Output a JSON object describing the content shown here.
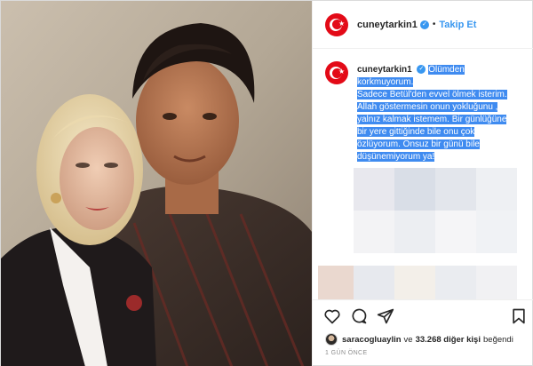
{
  "post": {
    "username": "cuneytarkin1",
    "verified_glyph": "✓",
    "separator": "•",
    "follow_label": "Takip Et",
    "caption_username": "cuneytarkin1",
    "caption_lines": [
      "Ölümden",
      "korkmuyorum.",
      "Sadece Betül'den evvel ölmek isterim.",
      "Allah göstermesin onun yokluğunu ,",
      "yalnız kalmak istemem. Bir günlüğüne",
      "bir yere gittiğinde bile onu çok",
      "özlüyorum. Onsuz bir günü bile",
      "düşünemiyorum ya!"
    ],
    "liked_by_user": "saracogluaylin",
    "liked_connector": "ve",
    "likes_count": "33.268 diğer kişi",
    "liked_suffix": "beğendi",
    "timestamp": "1 gün önce"
  },
  "icons": {
    "avatar": "turkish-flag-icon",
    "verified": "verified-badge-icon",
    "like": "heart-icon",
    "comment": "comment-icon",
    "share": "share-icon",
    "save": "bookmark-icon"
  },
  "colors": {
    "accent_blue": "#3897f0",
    "selection_blue": "#3f8bf0",
    "flag_red": "#e30a17",
    "text": "#262626",
    "muted": "#8e8e8e"
  }
}
